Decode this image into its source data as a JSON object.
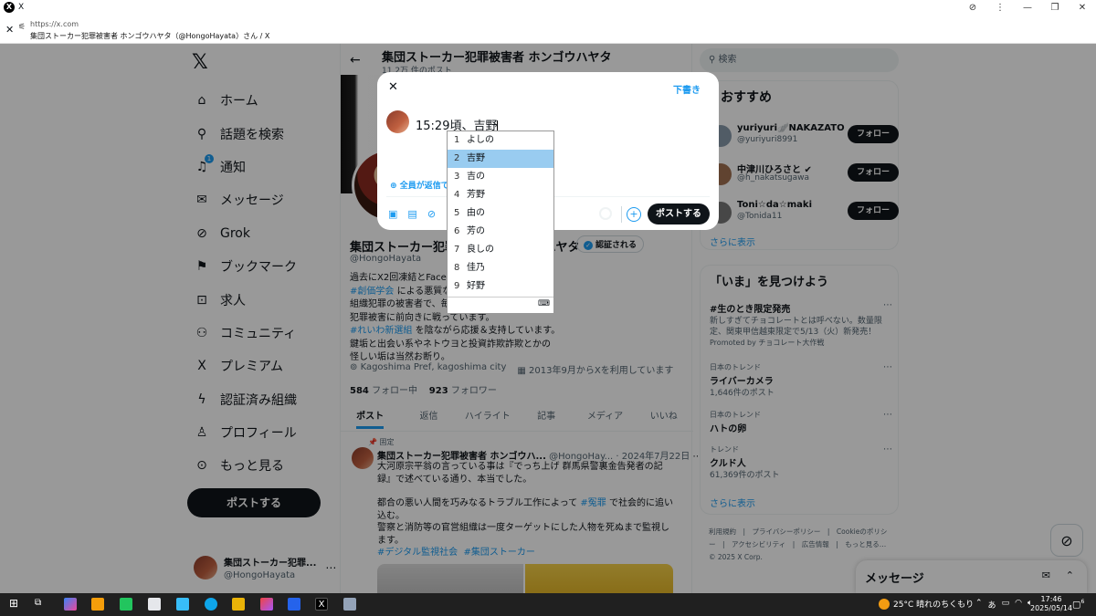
{
  "browser": {
    "tab_title": "X",
    "url": "https://x.com",
    "page_title": "集団ストーカー犯罪被害者 ホンゴウハヤタ（@HongoHayata）さん / X"
  },
  "nav": {
    "items": [
      {
        "label": "ホーム",
        "icon": "home-icon",
        "glyph": "⌂"
      },
      {
        "label": "話題を検索",
        "icon": "search-icon",
        "glyph": "⚲"
      },
      {
        "label": "通知",
        "icon": "bell-icon",
        "glyph": "♫",
        "badge": "1"
      },
      {
        "label": "メッセージ",
        "icon": "mail-icon",
        "glyph": "✉"
      },
      {
        "label": "Grok",
        "icon": "grok-icon",
        "glyph": "⊘"
      },
      {
        "label": "ブックマーク",
        "icon": "bookmark-icon",
        "glyph": "⚑"
      },
      {
        "label": "求人",
        "icon": "briefcase-icon",
        "glyph": "⊡"
      },
      {
        "label": "コミュニティ",
        "icon": "community-icon",
        "glyph": "⚇"
      },
      {
        "label": "プレミアム",
        "icon": "x-premium-icon",
        "glyph": "X"
      },
      {
        "label": "認証済み組織",
        "icon": "lightning-icon",
        "glyph": "ϟ"
      },
      {
        "label": "プロフィール",
        "icon": "person-icon",
        "glyph": "♙"
      },
      {
        "label": "もっと見る",
        "icon": "more-circle-icon",
        "glyph": "⊙"
      }
    ],
    "post_button": "ポストする",
    "user_name": "集団ストーカー犯罪...",
    "user_handle": "@HongoHayata"
  },
  "profile": {
    "header_name": "集団ストーカー犯罪被害者 ホンゴウハヤタ",
    "post_count": "11.2万 件のポスト",
    "name": "集団ストーカー犯罪被害者 ホンゴウハヤタ",
    "verify_button": "認証される",
    "handle": "@HongoHayata",
    "bio": [
      {
        "text": "過去にX2回凍結とFacebook",
        "tag": ""
      },
      {
        "tag": "#創価学会",
        "text": " による悪質な"
      },
      {
        "text": "組織犯罪の被害者で、毎日",
        "tag": ""
      },
      {
        "text": "犯罪被害に前向きに戦っています。",
        "tag": ""
      },
      {
        "tag": "#れいわ新選組",
        "text": " を陰ながら応援＆支持しています。"
      },
      {
        "text": "鍵垢と出会い系やネトウヨと投資詐欺詐欺とかの",
        "tag": ""
      },
      {
        "text": "怪しい垢は当然お断り。",
        "tag": ""
      }
    ],
    "location": "Kagoshima Pref, kagoshima city",
    "joined": "2013年9月からXを利用しています",
    "following_count": "584",
    "following_label": "フォロー中",
    "followers_count": "923",
    "followers_label": "フォロワー",
    "tabs": [
      "ポスト",
      "返信",
      "ハイライト",
      "記事",
      "メディア",
      "いいね"
    ]
  },
  "tweet": {
    "pinned": "固定",
    "name": "集団ストーカー犯罪被害者 ホンゴウハ...",
    "handle_date": "@HongoHay... · 2024年7月22日",
    "line1": "大河原宗平翁の言っている事は『でっち上げ 群馬県警裏金告発者の記録』で述べている通り、本当でした。",
    "line2_pre": "都合の悪い人間を巧みなるトラブル工作によって ",
    "line2_tag": "#冤罪",
    "line2_post": " で社会的に追い込む。",
    "line3": "警察と消防等の官営組織は一度ターゲットにした人物を死ぬまで監視します。",
    "tag1": "#デジタル監視社会",
    "tag2": "#集団ストーカー"
  },
  "right": {
    "search_placeholder": "検索",
    "rec_title": "おすすめ",
    "follow_label": "フォロー",
    "recs": [
      {
        "name": "yuriyuri🪽NAKAZATO",
        "handle": "@yuriyuri8991",
        "color": "#8899aa"
      },
      {
        "name": "中津川ひろさと ✔",
        "handle": "@h_nakatsugawa",
        "color": "#a07050"
      },
      {
        "name": "Toni☆da☆maki",
        "handle": "@Tonida11",
        "color": "#777777"
      }
    ],
    "show_more": "さらに表示",
    "trend_title": "「いま」を見つけよう",
    "trends": [
      {
        "cat": "",
        "title": "#生のとき限定発売",
        "desc": "新しすぎてチョコレートとは呼べない。数量限定、関東甲信越東限定で5/13（火）新発売！",
        "extra": "Promoted by チョコレート大作戦"
      },
      {
        "cat": "日本のトレンド",
        "title": "ライバーカメラ",
        "desc": "1,646件のポスト",
        "extra": ""
      },
      {
        "cat": "日本のトレンド",
        "title": "ハトの卵",
        "desc": "",
        "extra": ""
      },
      {
        "cat": "トレンド",
        "title": "クルド人",
        "desc": "61,369件のポスト",
        "extra": ""
      }
    ],
    "footer_links": [
      "利用規約",
      "プライバシーポリシー",
      "Cookieのポリシー",
      "アクセシビリティ",
      "広告情報",
      "もっと見る…"
    ],
    "copyright": "© 2025 X Corp.",
    "messages_title": "メッセージ"
  },
  "compose": {
    "draft_label": "下書き",
    "text_before": "15:29頃、",
    "text_composing": "吉野",
    "reply_setting": "全員が返信で",
    "post_button": "ポストする"
  },
  "ime": {
    "candidates": [
      "よしの",
      "吉野",
      "吉の",
      "芳野",
      "由の",
      "芳の",
      "良しの",
      "佳乃",
      "好野"
    ],
    "selected_index": 1
  },
  "taskbar": {
    "weather": "25°C 晴れのちくもり",
    "time": "17:46",
    "date": "2025/05/14",
    "notif_count": "6"
  }
}
